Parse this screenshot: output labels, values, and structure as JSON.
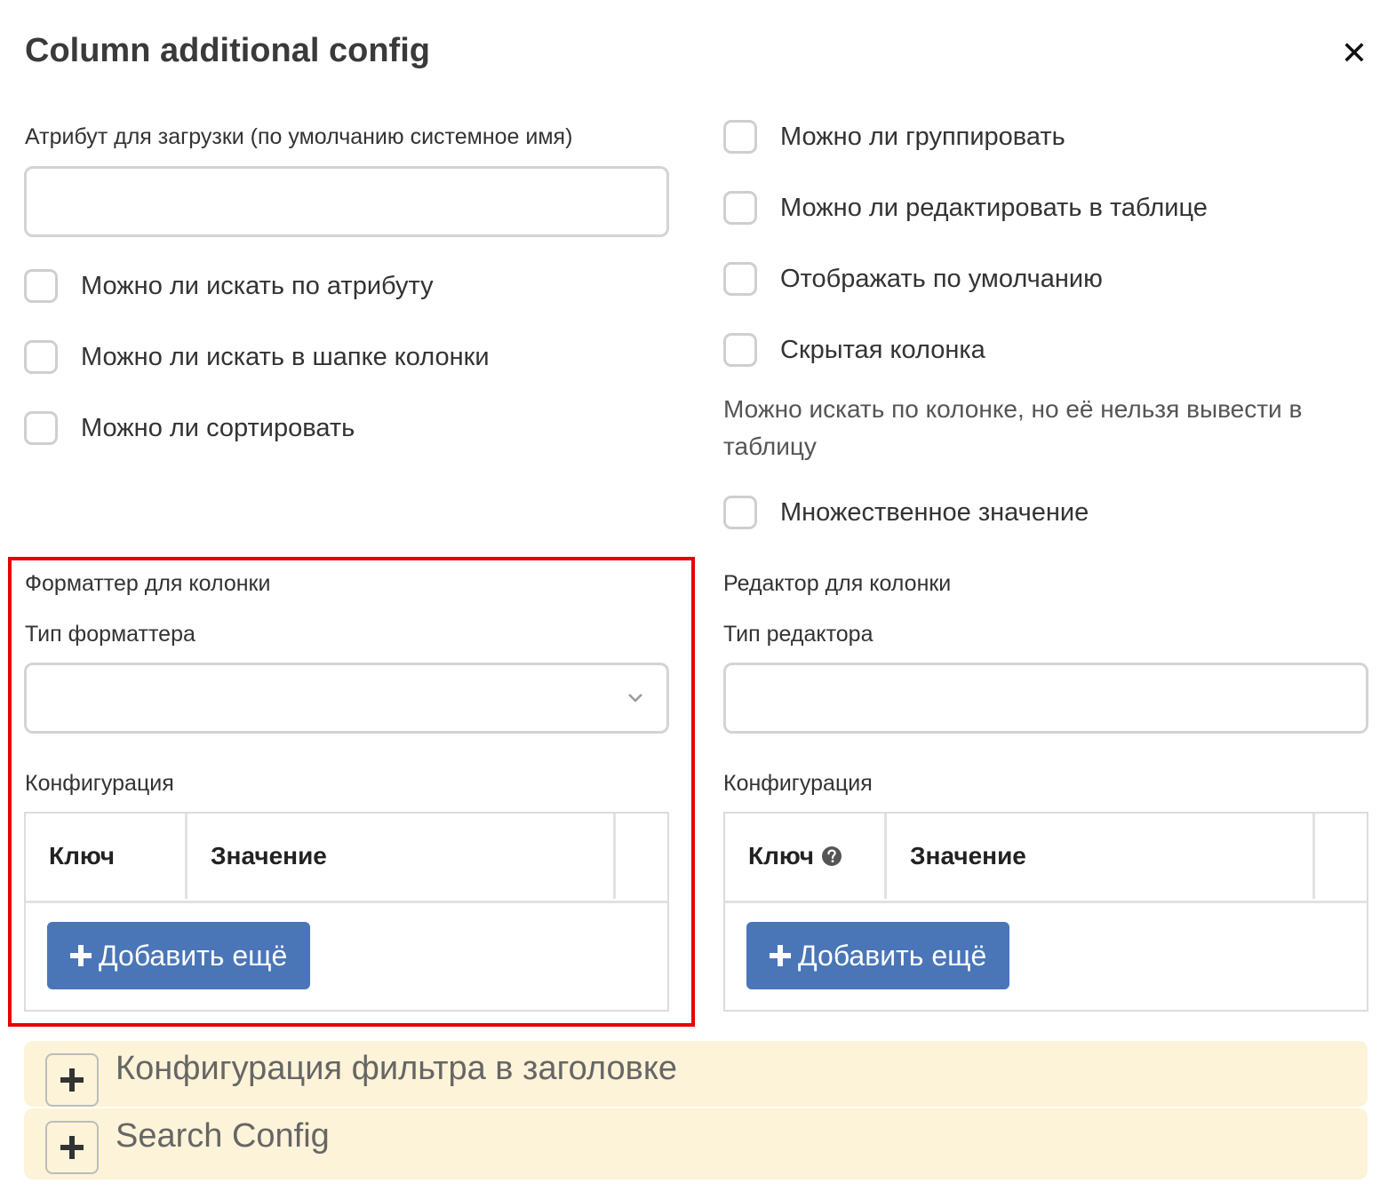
{
  "dialog": {
    "title": "Column additional config",
    "close_label": "✕"
  },
  "left": {
    "attr_label": "Атрибут для загрузки (по умолчанию системное имя)",
    "attr_value": "",
    "checkboxes": [
      {
        "label": "Можно ли искать по атрибуту",
        "checked": false
      },
      {
        "label": "Можно ли искать в шапке колонки",
        "checked": false
      },
      {
        "label": "Можно ли сортировать",
        "checked": false
      }
    ]
  },
  "right": {
    "checkboxes": [
      {
        "label": "Можно ли группировать",
        "checked": false
      },
      {
        "label": "Можно ли редактировать в таблице",
        "checked": false
      },
      {
        "label": "Отображать по умолчанию",
        "checked": false
      },
      {
        "label": "Скрытая колонка",
        "checked": false
      }
    ],
    "hidden_desc": "Можно искать по колонке, но её нельзя вывести в таблицу",
    "multi_checkbox": {
      "label": "Множественное значение",
      "checked": false
    }
  },
  "formatter": {
    "section_label": "Форматтер для колонки",
    "type_label": "Тип форматтера",
    "type_value": "",
    "config_label": "Конфигурация",
    "col_key": "Ключ",
    "col_value": "Значение",
    "add_label": "Добавить ещё"
  },
  "editor": {
    "section_label": "Редактор для колонки",
    "type_label": "Тип редактора",
    "type_value": "",
    "config_label": "Конфигурация",
    "col_key": "Ключ",
    "col_value": "Значение",
    "add_label": "Добавить ещё"
  },
  "accordions": [
    {
      "title": "Конфигурация фильтра в заголовке"
    },
    {
      "title": "Search Config"
    }
  ],
  "colors": {
    "accent": "#4a76b8",
    "highlight": "#e60000",
    "accordion_bg": "#fdf3d8"
  }
}
